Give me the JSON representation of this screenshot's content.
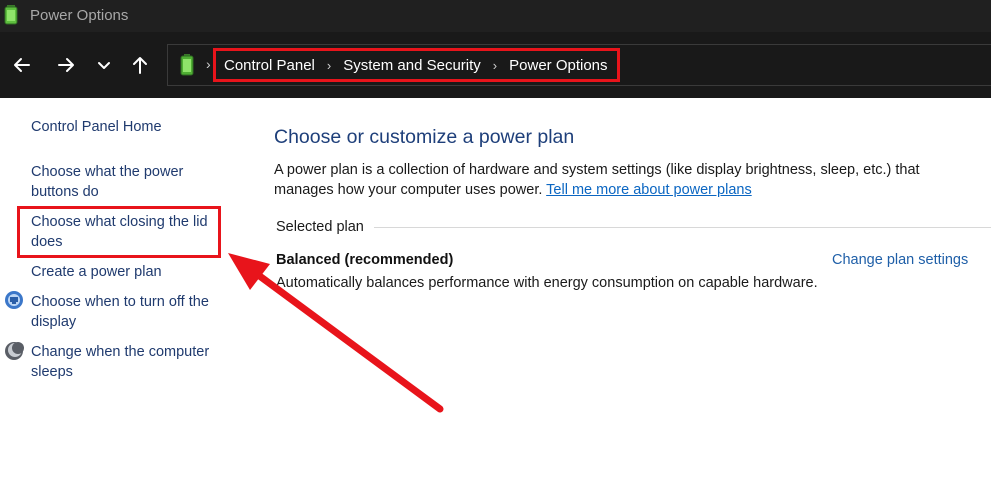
{
  "window": {
    "title": "Power Options"
  },
  "nav": {
    "back_icon": "arrow-left",
    "forward_icon": "arrow-right",
    "recent_icon": "chevron-down",
    "up_icon": "arrow-up"
  },
  "breadcrumb": {
    "items": [
      "Control Panel",
      "System and Security",
      "Power Options"
    ]
  },
  "sidebar": {
    "items": [
      {
        "label_lines": [
          "Control Panel Home"
        ]
      },
      {
        "label_lines": [
          "Choose what the power",
          "buttons do"
        ]
      },
      {
        "label_lines": [
          "Choose what closing the lid",
          "does"
        ]
      },
      {
        "label_lines": [
          "Create a power plan"
        ]
      },
      {
        "label_lines": [
          "Choose when to turn off the",
          "display"
        ],
        "icon": "monitor-icon"
      },
      {
        "label_lines": [
          "Change when the computer",
          "sleeps"
        ],
        "icon": "moon-icon"
      }
    ]
  },
  "main": {
    "heading": "Choose or customize a power plan",
    "description_line1": "A power plan is a collection of hardware and system settings (like display brightness, sleep, etc.) that",
    "description_line2": "manages how your computer uses power. ",
    "description_link": "Tell me more about power plans",
    "selected_label": "Selected plan",
    "plan_name": "Balanced (recommended)",
    "plan_description": "Automatically balances performance with energy consumption on capable hardware.",
    "change_link": "Change plan settings"
  },
  "annotation": {
    "color": "#e8141b"
  }
}
